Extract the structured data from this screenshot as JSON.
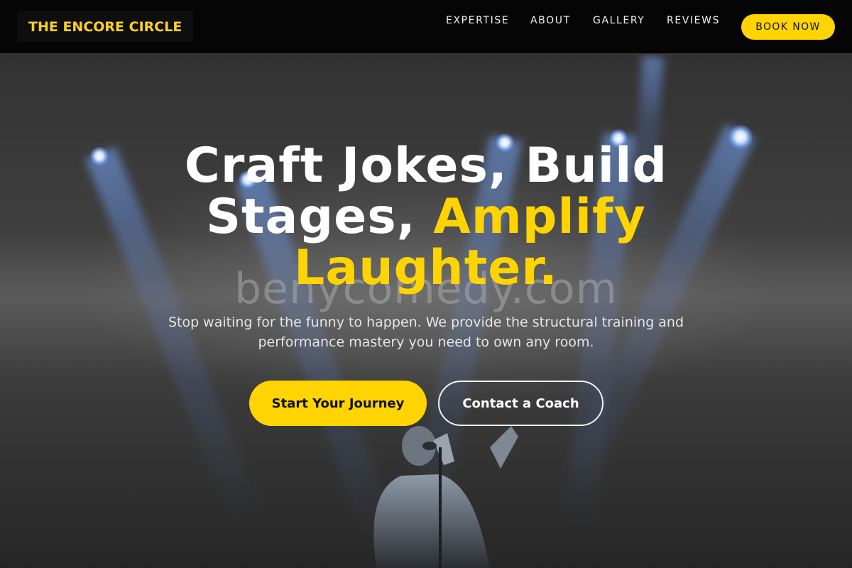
{
  "brand": {
    "name": "THE ENCORE CIRCLE"
  },
  "nav": {
    "links": [
      "EXPERTISE",
      "ABOUT",
      "GALLERY",
      "REVIEWS"
    ],
    "cta": "BOOK NOW"
  },
  "hero": {
    "headline_part1": "Craft Jokes, Build Stages, ",
    "headline_accent": "Amplify Laughter.",
    "subtitle": "Stop waiting for the funny to happen. We provide the structural training and performance mastery you need to own any room.",
    "primary_cta": "Start Your Journey",
    "secondary_cta": "Contact a Coach",
    "watermark": "benycomedy.com",
    "background_description": ""
  },
  "colors": {
    "accent": "#ffd400",
    "navbar": "#050505",
    "text": "#ffffff"
  }
}
